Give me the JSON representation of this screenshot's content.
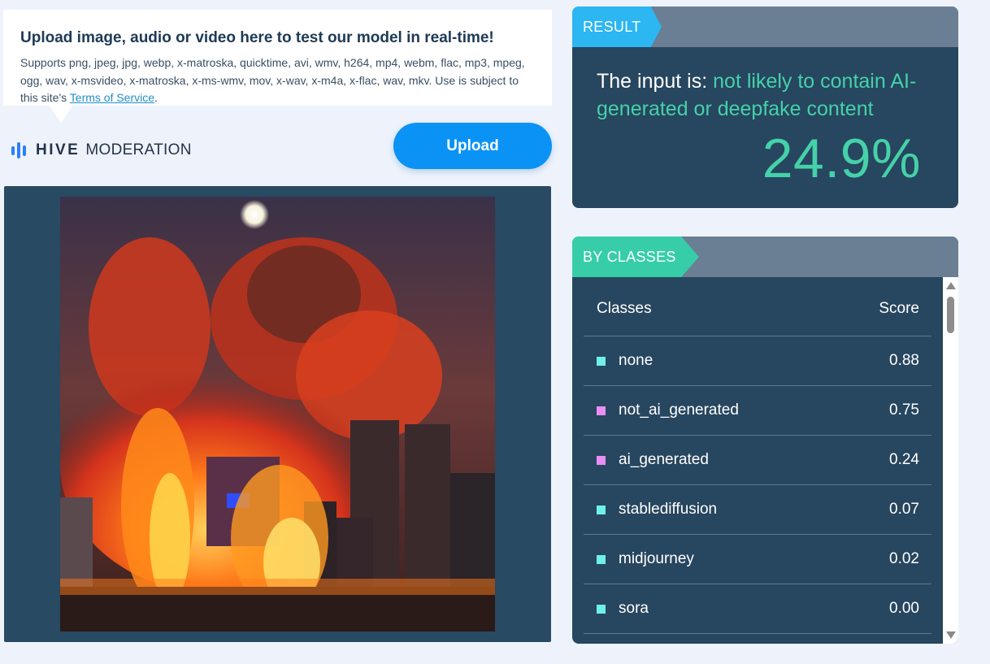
{
  "info": {
    "title": "Upload image, audio or video here to test our model in real-time!",
    "description": "Supports png, jpeg, jpg, webp, x-matroska, quicktime, avi, wmv, h264, mp4, webm, flac, mp3, mpeg, ogg, wav, x-msvideo, x-matroska, x-ms-wmv, mov, x-wav, x-m4a, x-flac, wav, mkv. Use is subject to this site's ",
    "terms_link": "Terms of Service",
    "terms_suffix": "."
  },
  "logo": {
    "brand": "HIVE",
    "product": "MODERATION",
    "icon": "hive-bars-icon",
    "color": "#2d7ff9"
  },
  "upload_button": {
    "label": "Upload"
  },
  "preview": {
    "subject": "night city skyline with buildings on fire and a full moon"
  },
  "result": {
    "tag": "RESULT",
    "prefix": "The input is: ",
    "verdict": "not likely to contain AI-generated or deepfake content",
    "score": "24.9%"
  },
  "classes": {
    "tag": "BY CLASSES",
    "col_class": "Classes",
    "col_score": "Score",
    "rows": [
      {
        "name": "none",
        "score": "0.88",
        "color": "#6ff0ea"
      },
      {
        "name": "not_ai_generated",
        "score": "0.75",
        "color": "#ea8ef5"
      },
      {
        "name": "ai_generated",
        "score": "0.24",
        "color": "#ea8ef5"
      },
      {
        "name": "stablediffusion",
        "score": "0.07",
        "color": "#6ff0ea"
      },
      {
        "name": "midjourney",
        "score": "0.02",
        "color": "#6ff0ea"
      },
      {
        "name": "sora",
        "score": "0.00",
        "color": "#6ff0ea"
      }
    ]
  },
  "colors": {
    "accent_blue": "#0a93f5",
    "result_tag": "#2cb6f2",
    "classes_tag": "#37cda8",
    "verdict_green": "#45d1a9",
    "panel_bg": "#27465f"
  }
}
